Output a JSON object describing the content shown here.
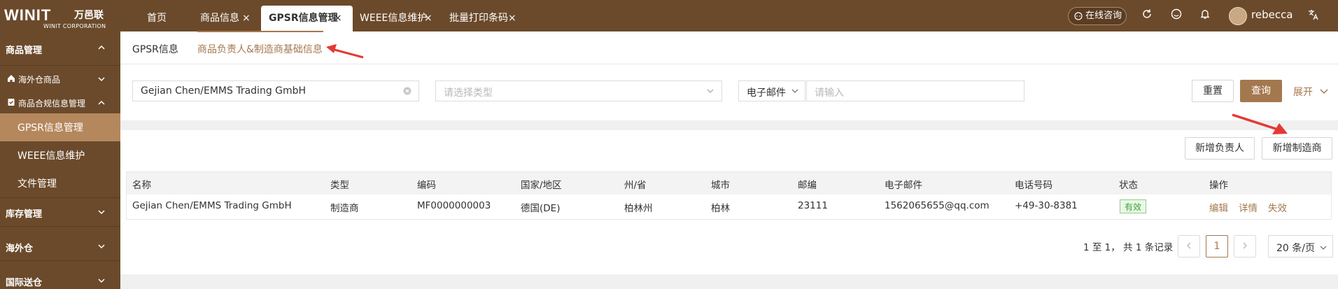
{
  "brand": {
    "mark": "WINIT",
    "name_cn": "万邑联",
    "name_en": "WINIT CORPORATION"
  },
  "tabs": [
    {
      "label": "首页"
    },
    {
      "label": "商品信息"
    },
    {
      "label": "GPSR信息管理"
    },
    {
      "label": "WEEE信息维护"
    },
    {
      "label": "批量打印条码"
    }
  ],
  "tab_close_glyph": "×",
  "header": {
    "consult_label": "在线咨询",
    "username": "rebecca",
    "icons": [
      "chat-icon",
      "refresh-icon",
      "smile-icon",
      "bell-icon",
      "translate-icon"
    ]
  },
  "sidebar": {
    "group_product": "商品管理",
    "overseas_goods": "海外仓商品",
    "compliance": "商品合规信息管理",
    "items": [
      {
        "label": "GPSR信息管理"
      },
      {
        "label": "WEEE信息维护"
      },
      {
        "label": "文件管理"
      }
    ],
    "group_inventory": "库存管理",
    "group_overseas": "海外仓",
    "group_intl": "国际送仓"
  },
  "subtabs": [
    {
      "label": "GPSR信息"
    },
    {
      "label": "商品负责人&制造商基础信息"
    }
  ],
  "filters": {
    "name_value": "Gejian Chen/EMMS Trading GmbH",
    "type_placeholder": "请选择类型",
    "field_select": "电子邮件",
    "field_placeholder": "请输入",
    "reset_label": "重置",
    "query_label": "查询",
    "expand_label": "展开"
  },
  "actions": {
    "add_responsible": "新增负责人",
    "add_manufacturer": "新增制造商"
  },
  "table": {
    "columns": [
      "名称",
      "类型",
      "编码",
      "国家/地区",
      "州/省",
      "城市",
      "邮编",
      "电子邮件",
      "电话号码",
      "状态",
      "操作"
    ],
    "rows": [
      {
        "name": "Gejian Chen/EMMS Trading GmbH",
        "type": "制造商",
        "code": "MF0000000003",
        "country": "德国(DE)",
        "state": "柏林州",
        "city": "柏林",
        "zip": "23111",
        "email": "1562065655@qq.com",
        "phone": "+49-30-8381",
        "status": "有效",
        "ops": [
          "编辑",
          "详情",
          "失效"
        ]
      }
    ]
  },
  "pagination": {
    "summary": "1 至 1， 共 1 条记录",
    "current_page": "1",
    "page_size": "20 条/页"
  },
  "colors": {
    "brand_brown": "#6b4a2b",
    "accent": "#a4784e",
    "active_menu": "#b5875c",
    "annotation_red": "#e53935"
  }
}
